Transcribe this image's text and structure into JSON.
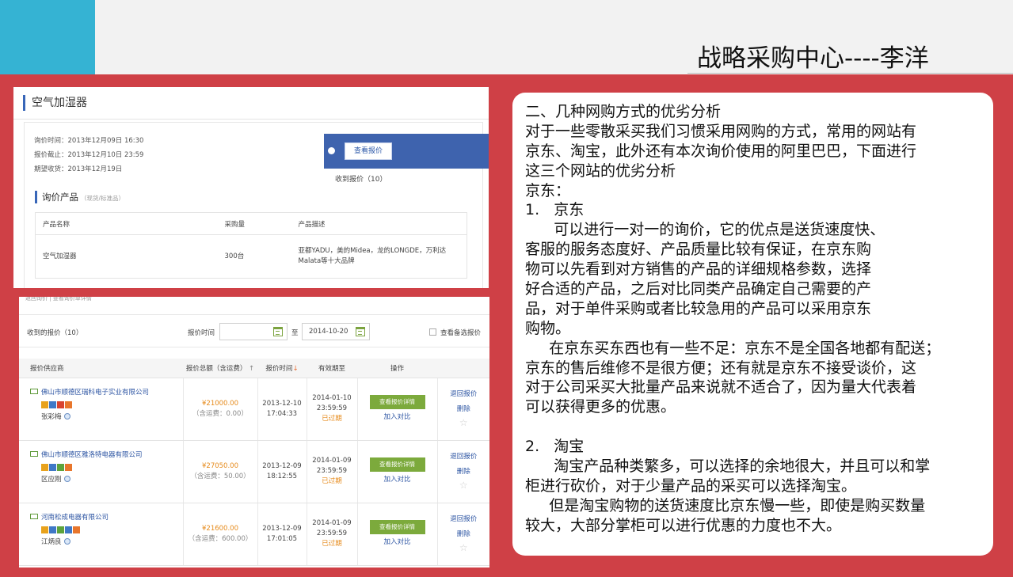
{
  "slide": {
    "title": "战略采购中心----李洋"
  },
  "colors": {
    "teal": "#35b3d3",
    "red": "#cf4046",
    "blue_accent": "#3e63ae",
    "green_button": "#7caa3c",
    "price_orange": "#e68a1a"
  },
  "inquiry": {
    "heading": "空气加湿器",
    "info_lines": [
      "询价时间：2013年12月09日 16:30",
      "报价截止：2013年12月10日 23:59",
      "期望收货：2013年12月19日"
    ],
    "view_quotes_button": "查看报价",
    "received_count": "收到报价（10）",
    "products_heading": "询价产品",
    "products_subtitle": "（现货/标准品）",
    "columns": [
      "产品名称",
      "采购量",
      "产品描述"
    ],
    "row": {
      "name": "空气加湿器",
      "quantity": "300台",
      "desc_line1": "亚都YADU，美的Midea，龙的LONGDE，万利达",
      "desc_line2": "Malata等十大品牌"
    }
  },
  "quotes": {
    "top_strip": "返回询价 | 查看询价单详情",
    "received_label": "收到的报价（10）",
    "time_label": "报价时间",
    "to_label": "至",
    "date_to": "2014-10-20",
    "show_selected_label": "查看备选报价",
    "columns": {
      "supplier": "报价供应商",
      "total": "报价总额（含运费）",
      "time": "报价时间",
      "valid": "有效期至",
      "action": "操作"
    },
    "sort_up": "↑",
    "sort_down": "↓",
    "detail_button": "查看报价详情",
    "compare_link": "加入对比",
    "return_link": "退回报价",
    "delete_link": "删除",
    "rows": [
      {
        "supplier": "佛山市顺德区瑞科电子实业有限公司",
        "contact": "张彩梅",
        "price": "¥21000.00",
        "shipping": "（含运费：0.00）",
        "date": "2013-12-10",
        "time": "17:04:33",
        "valid_date": "2014-01-10",
        "valid_time": "23:59:59",
        "status": "已过期"
      },
      {
        "supplier": "佛山市顺德区雅洛特电器有限公司",
        "contact": "区应刚",
        "price": "¥27050.00",
        "shipping": "（含运费：50.00）",
        "date": "2013-12-09",
        "time": "18:12:55",
        "valid_date": "2014-01-09",
        "valid_time": "23:59:59",
        "status": "已过期"
      },
      {
        "supplier": "河南松成电器有限公司",
        "contact": "江炳良",
        "price": "¥21600.00",
        "shipping": "（含运费：600.00）",
        "date": "2013-12-09",
        "time": "17:01:05",
        "valid_date": "2014-01-09",
        "valid_time": "23:59:59",
        "status": "已过期"
      }
    ]
  },
  "analysis": {
    "lines": [
      "二、几种网购方式的优劣分析",
      "对于一些零散采买我们习惯采用网购的方式，常用的网站有",
      "京东、淘宝，此外还有本次询价使用的阿里巴巴，下面进行",
      "这三个网站的优劣分析",
      "京东：",
      "1.   京东",
      "      可以进行一对一的询价，它的优点是送货速度快、",
      "客服的服务态度好、产品质量比较有保证，在京东购",
      "物可以先看到对方销售的产品的详细规格参数，选择",
      "好合适的产品，之后对比同类产品确定自己需要的产",
      "品，对于单件采购或者比较急用的产品可以采用京东",
      "购物。",
      "     在京东买东西也有一些不足：京东不是全国各地都有配送；",
      "京东的售后维修不是很方便；还有就是京东不接受谈价，这",
      "对于公司采买大批量产品来说就不适合了，因为量大代表着",
      "可以获得更多的优惠。",
      "",
      "2.   淘宝",
      "      淘宝产品种类繁多，可以选择的余地很大，并且可以和掌",
      "柜进行砍价，对于少量产品的采买可以选择淘宝。",
      "     但是淘宝购物的送货速度比京东慢一些，即使是购买数量",
      "较大，大部分掌柜可以进行优惠的力度也不大。"
    ]
  }
}
